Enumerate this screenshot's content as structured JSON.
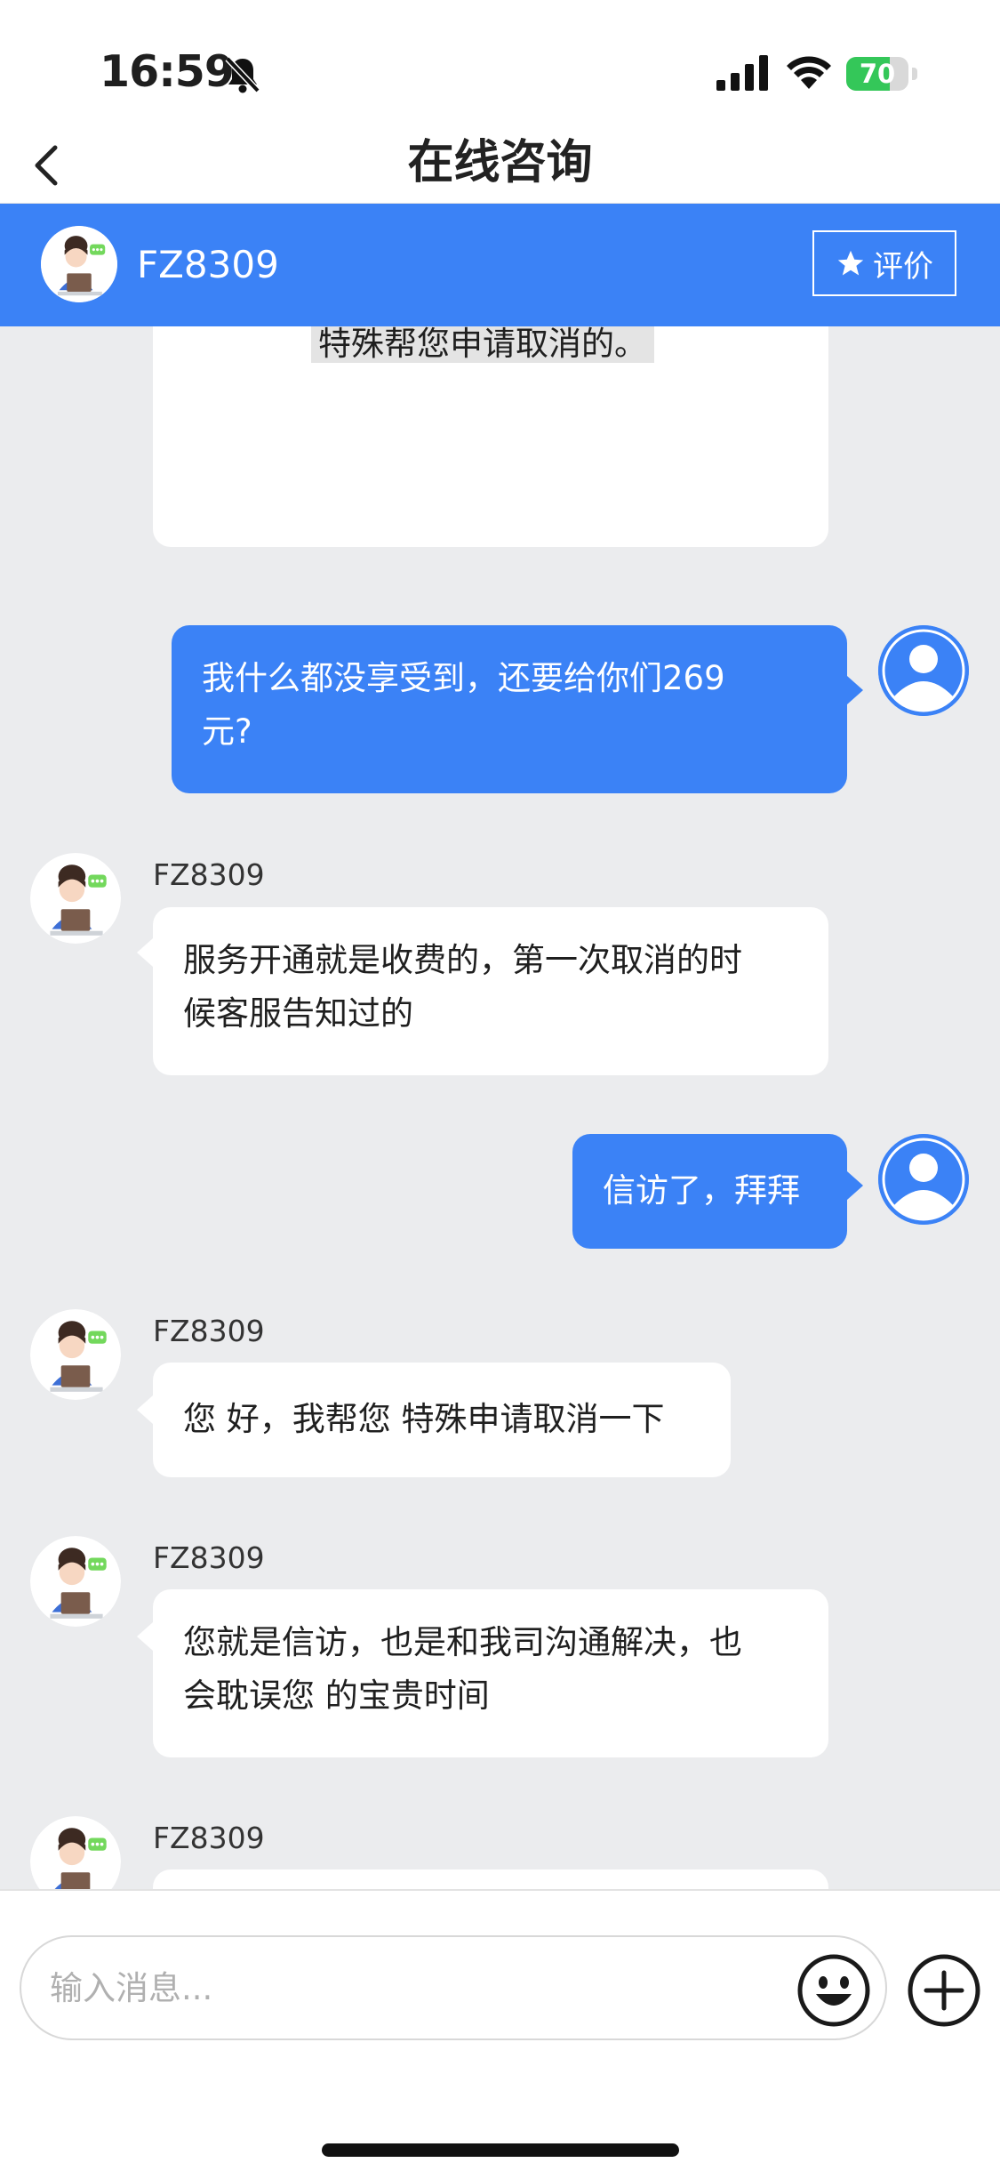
{
  "status_bar": {
    "time": "16:59",
    "battery": "70",
    "battery_level": 0.7,
    "colors": {
      "battery_fill": "#34c759"
    },
    "icons": [
      "bell-slash-icon",
      "cellular-signal-icon",
      "wifi-icon",
      "battery-charging-icon"
    ]
  },
  "nav": {
    "title": "在线咨询",
    "back_icon": "chevron-left-icon"
  },
  "agent": {
    "name": "FZ8309",
    "rate_label": "评价",
    "rate_icon": "star-icon",
    "avatar_icon": "agent-avatar-icon"
  },
  "messages": [
    {
      "from": "agent",
      "text": "特殊帮您申请取消的。"
    },
    {
      "from": "user",
      "line1": "我什么都没享受到，还要给你们269",
      "line2": "元?"
    },
    {
      "from": "agent",
      "sender": "FZ8309",
      "line1": "服务开通就是收费的，第一次取消的时",
      "line2": "候客服告知过的"
    },
    {
      "from": "user",
      "text": "信访了，拜拜"
    },
    {
      "from": "agent",
      "sender": "FZ8309",
      "text": "您 好，我帮您 特殊申请取消一下"
    },
    {
      "from": "agent",
      "sender": "FZ8309",
      "line1": "您就是信访，也是和我司沟通解决，也",
      "line2": "会耽误您 的宝贵时间"
    },
    {
      "from": "agent",
      "sender": "FZ8309",
      "text": ""
    }
  ],
  "input": {
    "placeholder": "输入消息...",
    "emoji_icon": "emoji-smile-icon",
    "add_icon": "plus-circle-icon"
  },
  "colors": {
    "primary": "#3b82f6",
    "chat_background": "#ebecee",
    "agent_bubble": "#ffffff"
  }
}
